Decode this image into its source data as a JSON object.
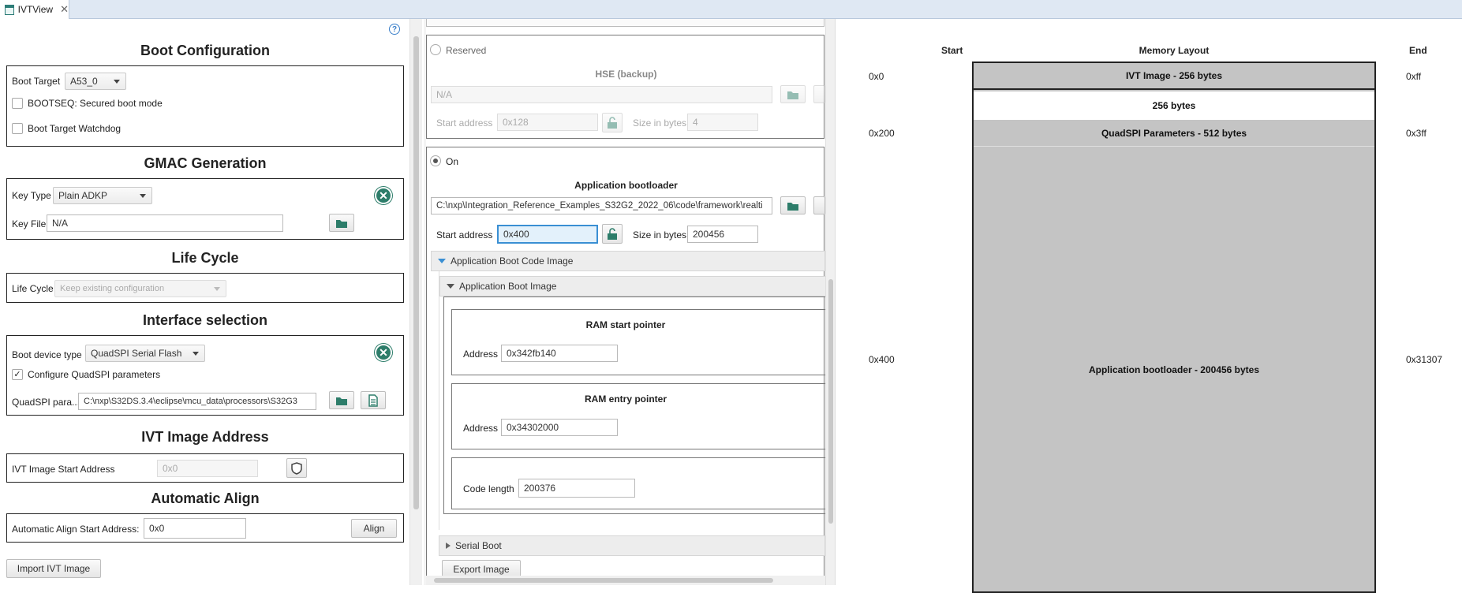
{
  "tab": {
    "title": "IVTView",
    "close": "✕"
  },
  "left": {
    "help": "?",
    "boot_config": {
      "title": "Boot Configuration",
      "boot_target_label": "Boot Target",
      "boot_target_value": "A53_0",
      "secured_boot_label": "BOOTSEQ: Secured boot mode",
      "watchdog_label": "Boot Target Watchdog"
    },
    "gmac": {
      "title": "GMAC Generation",
      "key_type_label": "Key Type",
      "key_type_value": "Plain ADKP",
      "key_file_label": "Key File",
      "key_file_value": "N/A"
    },
    "life_cycle": {
      "title": "Life Cycle",
      "label": "Life Cycle",
      "value": "Keep existing configuration"
    },
    "interface": {
      "title": "Interface selection",
      "boot_device_label": "Boot device type",
      "boot_device_value": "QuadSPI Serial Flash",
      "configure_label": "Configure QuadSPI parameters",
      "configure_checked": "✓",
      "quadspi_label": "QuadSPI para...",
      "quadspi_value": "C:\\nxp\\S32DS.3.4\\eclipse\\mcu_data\\processors\\S32G3"
    },
    "ivt_address": {
      "title": "IVT Image Address",
      "label": "IVT Image Start Address",
      "value": "0x0"
    },
    "auto_align": {
      "title": "Automatic Align",
      "label": "Automatic Align Start Address:",
      "value": "0x0",
      "button": "Align"
    },
    "import_button": "Import IVT Image"
  },
  "middle": {
    "reserved": {
      "radio_label": "Reserved",
      "title": "HSE (backup)",
      "path_value": "N/A",
      "start_label": "Start address",
      "start_value": "0x128",
      "size_label": "Size in bytes",
      "size_value": "4"
    },
    "on": {
      "radio_label": "On",
      "title": "Application bootloader",
      "path_value": "C:\\nxp\\Integration_Reference_Examples_S32G2_2022_06\\code\\framework\\realti",
      "start_label": "Start address",
      "start_value": "0x400",
      "size_label": "Size in bytes",
      "size_value": "200456"
    },
    "code_image_title": "Application Boot Code Image",
    "boot_image_title": "Application Boot Image",
    "ram_start": {
      "title": "RAM start pointer",
      "label": "Address",
      "value": "0x342fb140"
    },
    "ram_entry": {
      "title": "RAM entry pointer",
      "label": "Address",
      "value": "0x34302000"
    },
    "code_length": {
      "label": "Code length",
      "value": "200376"
    },
    "serial_boot": "Serial Boot",
    "export_button": "Export Image"
  },
  "memory": {
    "headers": {
      "start": "Start",
      "layout": "Memory Layout",
      "end": "End"
    },
    "rows": [
      {
        "start": "0x0",
        "label": "IVT Image - 256 bytes",
        "end": "0xff",
        "color": "#c4c4c4"
      },
      {
        "start": "",
        "label": "256 bytes",
        "end": "",
        "color": "#ffffff"
      },
      {
        "start": "0x200",
        "label": "QuadSPI Parameters - 512 bytes",
        "end": "0x3ff",
        "color": "#c4c4c4"
      },
      {
        "start": "0x400",
        "label": "Application bootloader - 200456 bytes",
        "end": "0x31307",
        "color": "#c4c4c4"
      }
    ]
  },
  "colors": {
    "accent": "#2d7d6a",
    "focus": "#3a8fd3",
    "memory_fill": "#c4c4c4"
  }
}
